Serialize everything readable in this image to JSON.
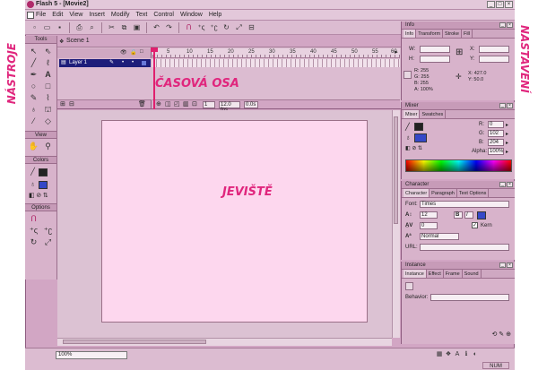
{
  "window": {
    "title": "Flash 5 - [Movie2]"
  },
  "menu": [
    "File",
    "Edit",
    "View",
    "Insert",
    "Modify",
    "Text",
    "Control",
    "Window",
    "Help"
  ],
  "tools": {
    "header": "Tools",
    "view_label": "View",
    "colors_label": "Colors",
    "options_label": "Options"
  },
  "timeline": {
    "scene_label": "Scene 1",
    "layer_name": "Layer 1",
    "ruler_numbers": [
      "5",
      "10",
      "15",
      "20",
      "25",
      "30",
      "35",
      "40",
      "45",
      "50",
      "55",
      "60"
    ],
    "frame": "1",
    "fps": "12.0 fps",
    "time": "0.0s"
  },
  "panels": {
    "info": {
      "title": "Info",
      "tabs": [
        "Info",
        "Transform",
        "Stroke",
        "Fill"
      ],
      "w_label": "W:",
      "h_label": "H:",
      "x_label": "X:",
      "y_label": "Y:",
      "r": "R: 255",
      "g": "G: 255",
      "b": "B: 255",
      "a": "A: 100%",
      "cx": "X: 427.0",
      "cy": "Y: 50.0"
    },
    "mixer": {
      "title": "Mixer",
      "tabs": [
        "Mixer",
        "Swatches"
      ],
      "r_label": "R:",
      "g_label": "G:",
      "b_label": "B:",
      "alpha_label": "Alpha:",
      "r": "0",
      "g": "102",
      "b": "204",
      "alpha": "100%"
    },
    "character": {
      "title": "Character",
      "tabs": [
        "Character",
        "Paragraph",
        "Text Options"
      ],
      "font_label": "Font:",
      "font": "Times",
      "size": "12",
      "tracking": "0",
      "baseline": "Normal",
      "kern_label": "Kern",
      "url_label": "URL:",
      "bold": "B",
      "italic": "I"
    },
    "instance": {
      "title": "Instance",
      "tabs": [
        "Instance",
        "Effect",
        "Frame",
        "Sound"
      ],
      "behavior_label": "Behavior:"
    }
  },
  "statusbar": {
    "zoom": "100%",
    "num": "NUM"
  },
  "annotations": {
    "tools": "NÁSTROJE",
    "timeline": "ČASOVÁ OSA",
    "stage": "JEVIŠTĚ",
    "panels": "NASTAVENÍ"
  },
  "colors": {
    "accent": "#e0267d",
    "stage": "#fdd7ee",
    "chrome": "#d2a6c4",
    "fill": "#3548c8"
  }
}
